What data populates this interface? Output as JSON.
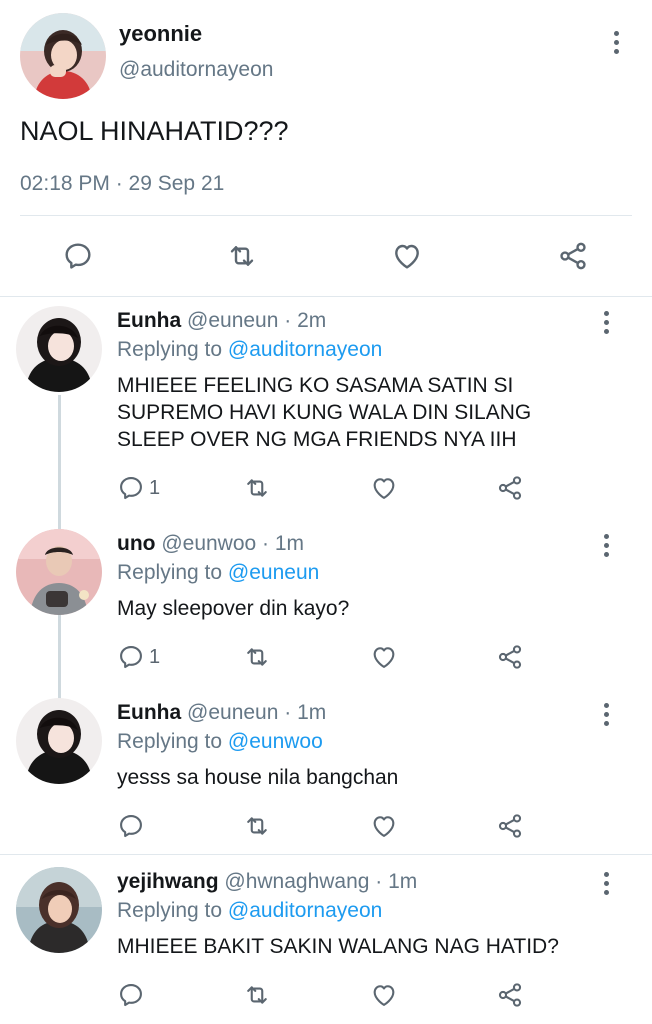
{
  "main_tweet": {
    "display_name": "yeonnie",
    "handle": "@auditornayeon",
    "text": "NAOL HINAHATID???",
    "timestamp": "02:18 PM · 29 Sep 21"
  },
  "replies": [
    {
      "display_name": "Eunha",
      "meta": "@euneun · 2m",
      "replying_prefix": "Replying to",
      "replying_to": "@auditornayeon",
      "text_lines": [
        "MHIEEE FEELING KO SASAMA SATIN SI",
        "SUPREMO HAVI KUNG WALA DIN SILANG",
        "SLEEP OVER NG MGA FRIENDS NYA IIH"
      ],
      "reply_count": "1"
    },
    {
      "display_name": "uno",
      "meta": "@eunwoo · 1m",
      "replying_prefix": "Replying to",
      "replying_to": "@euneun",
      "text_lines": [
        "May sleepover din kayo?"
      ],
      "reply_count": "1"
    },
    {
      "display_name": "Eunha",
      "meta": "@euneun · 1m",
      "replying_prefix": "Replying to",
      "replying_to": "@eunwoo",
      "text_lines": [
        "yesss sa house nila bangchan"
      ],
      "reply_count": ""
    },
    {
      "display_name": "yejihwang",
      "meta": "@hwnaghwang · 1m",
      "replying_prefix": "Replying to",
      "replying_to": "@auditornayeon",
      "text_lines": [
        "MHIEEE BAKIT SAKIN WALANG NAG HATID?"
      ],
      "reply_count": ""
    }
  ],
  "icons": {
    "reply": "reply-icon",
    "retweet": "retweet-icon",
    "like": "heart-icon",
    "share": "share-icon",
    "more": "more-vertical-icon"
  },
  "colors": {
    "link": "#1d9bf0",
    "secondary_text": "#657786",
    "divider": "#e1e8ed"
  }
}
